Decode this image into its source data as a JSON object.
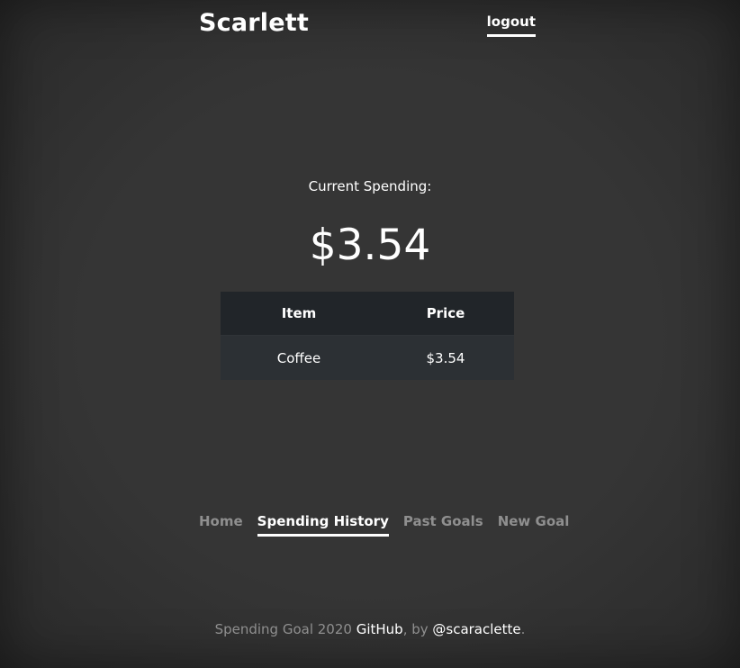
{
  "header": {
    "brand": "Scarlett",
    "logout_label": "logout"
  },
  "main": {
    "current_label": "Current Spending:",
    "amount": "$3.54",
    "table": {
      "headers": [
        "Item",
        "Price"
      ],
      "rows": [
        [
          "Coffee",
          "$3.54"
        ]
      ]
    }
  },
  "nav": {
    "tabs": [
      {
        "label": "Home",
        "active": false
      },
      {
        "label": "Spending History",
        "active": true
      },
      {
        "label": "Past Goals",
        "active": false
      },
      {
        "label": "New Goal",
        "active": false
      }
    ]
  },
  "footer": {
    "prefix": "Spending Goal 2020 ",
    "github_label": "GitHub",
    "middle": ", by ",
    "author_label": "@scaraclette",
    "suffix": "."
  },
  "colors": {
    "background": "#333333",
    "text": "#ffffff",
    "muted": "#8f8f8f",
    "table_header": "#212529",
    "table_row": "#2c3034"
  }
}
